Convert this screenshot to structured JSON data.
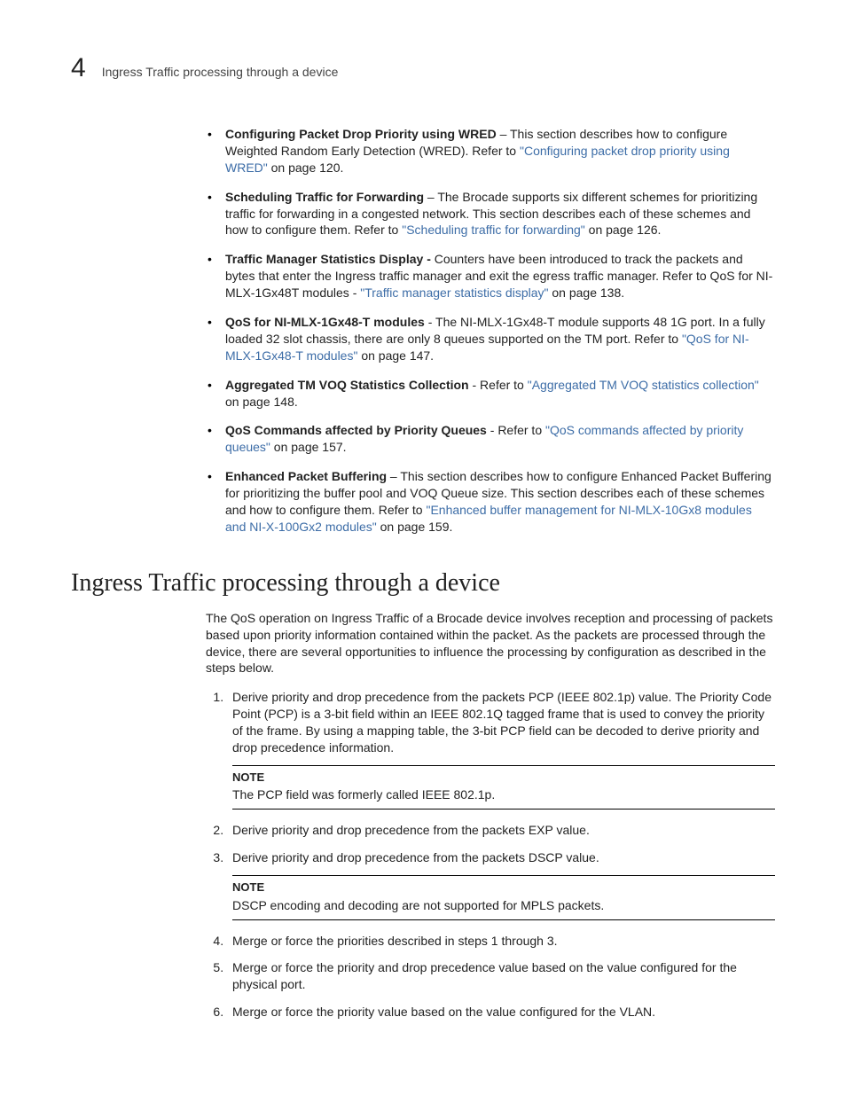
{
  "header": {
    "chapter_number": "4",
    "title": "Ingress Traffic processing through a device"
  },
  "bullets": [
    {
      "bold": "Configuring Packet Drop Priority using WRED",
      "sep": " – ",
      "text_before_link": "This section describes how to configure Weighted Random Early Detection (WRED). Refer to ",
      "link": "\"Configuring packet drop priority using WRED\"",
      "text_after_link": " on page 120."
    },
    {
      "bold": "Scheduling Traffic for Forwarding",
      "sep": " – ",
      "text_before_link": "The Brocade supports six different schemes for prioritizing traffic for forwarding in a congested network. This section describes each of these schemes and how to configure them. Refer to ",
      "link": "\"Scheduling traffic for forwarding\"",
      "text_after_link": " on page 126."
    },
    {
      "bold": "Traffic Manager Statistics Display -",
      "sep": " ",
      "text_before_link": "Counters have been introduced to track the packets and bytes that enter the Ingress traffic manager and exit the egress traffic manager. Refer to QoS for NI-MLX-1Gx48T modules - ",
      "link": "\"Traffic manager statistics display\"",
      "text_after_link": " on page 138."
    },
    {
      "bold": "QoS for NI-MLX-1Gx48-T modules",
      "sep": " - ",
      "text_before_link": "The NI-MLX-1Gx48-T module supports 48 1G port. In a fully loaded 32 slot chassis, there are only 8 queues supported on the TM port. Refer to ",
      "link": "\"QoS for NI-MLX-1Gx48-T modules\"",
      "text_after_link": " on page 147."
    },
    {
      "bold": "Aggregated TM VOQ Statistics Collection",
      "sep": " - ",
      "text_before_link": "Refer to ",
      "link": "\"Aggregated TM VOQ statistics collection\"",
      "text_after_link": " on page 148."
    },
    {
      "bold": "QoS Commands affected by Priority Queues",
      "sep": " - ",
      "text_before_link": "Refer to ",
      "link": "\"QoS commands affected by priority queues\"",
      "text_after_link": " on page 157."
    },
    {
      "bold": "Enhanced Packet Buffering",
      "sep": " – ",
      "text_before_link": "This section describes how to configure Enhanced Packet Buffering for prioritizing the buffer pool and VOQ Queue size. This section describes each of these schemes and how to configure them. Refer to ",
      "link": "\"Enhanced buffer management for NI-MLX-10Gx8 modules and NI-X-100Gx2 modules\"",
      "text_after_link": " on page 159."
    }
  ],
  "section_heading": "Ingress Traffic processing through a device",
  "intro_paragraph": "The QoS operation on Ingress Traffic of a Brocade device involves reception and processing of packets based upon priority information contained within the packet. As the packets are processed through the device, there are several opportunities to influence the processing by configuration as described in the steps below.",
  "steps": {
    "s1": "Derive priority and drop precedence from the packets PCP (IEEE 802.1p) value. The Priority Code Point (PCP) is a 3-bit field within an IEEE 802.1Q tagged frame that is used to convey the priority of the frame. By using a mapping table, the 3-bit PCP field can be decoded to derive priority and drop precedence information.",
    "note1_title": "NOTE",
    "note1_body": "The PCP field was formerly called IEEE 802.1p.",
    "s2": "Derive priority and drop precedence from the packets EXP value.",
    "s3": "Derive priority and drop precedence from the packets DSCP value.",
    "note2_title": "NOTE",
    "note2_body": "DSCP encoding and decoding are not supported for MPLS packets.",
    "s4": "Merge or force the priorities described in steps 1 through 3.",
    "s5": "Merge or force the priority and drop precedence value based on the value configured for the physical port.",
    "s6": "Merge or force the priority value based on the value configured for the VLAN."
  }
}
